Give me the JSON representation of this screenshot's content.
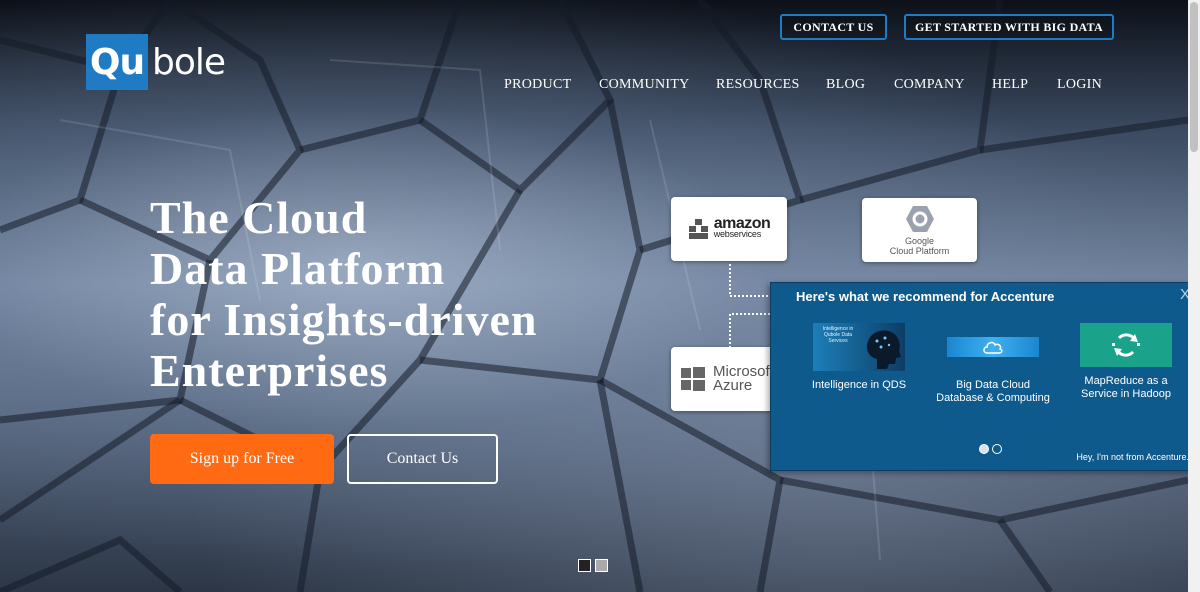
{
  "logo": {
    "part1": "Qu",
    "part2": "bole"
  },
  "header_buttons": {
    "contact": "CONTACT US",
    "get_started": "GET STARTED WITH BIG DATA"
  },
  "nav": [
    {
      "label": "PRODUCT"
    },
    {
      "label": "COMMUNITY"
    },
    {
      "label": "RESOURCES"
    },
    {
      "label": "BLOG"
    },
    {
      "label": "COMPANY"
    },
    {
      "label": "HELP"
    },
    {
      "label": "LOGIN"
    }
  ],
  "hero": {
    "lines": [
      "The Cloud",
      "Data Platform",
      "for Insights-driven",
      "Enterprises"
    ],
    "signup_label": "Sign up for Free",
    "contact_label": "Contact Us"
  },
  "platforms": {
    "aws": {
      "big": "amazon",
      "small": "webservices"
    },
    "gcp": {
      "line1": "Google",
      "line2": "Cloud Platform"
    },
    "azure": {
      "line1": "Microsoft",
      "line2": "Azure"
    }
  },
  "recommendations": {
    "title": "Here's what we recommend for Accenture",
    "close": "X",
    "items": [
      {
        "label": "Intelligence in QDS",
        "thumb_caption": "Intelligence in Qubole Data Services",
        "icon": "ai-head-thumbnail"
      },
      {
        "label": "Big Data Cloud Database & Computing",
        "thumb_caption": "",
        "icon": "cloud-database-thumbnail"
      },
      {
        "label": "MapReduce as a Service in Hadoop",
        "thumb_caption": "",
        "icon": "mapreduce-thumbnail"
      }
    ],
    "footer": "Hey, I'm not from Accenture."
  },
  "colors": {
    "brand_blue": "#1f7bc4",
    "cta_orange": "#ff6a13",
    "panel_blue": "#0f5a8c",
    "teal": "#1aa38a"
  }
}
